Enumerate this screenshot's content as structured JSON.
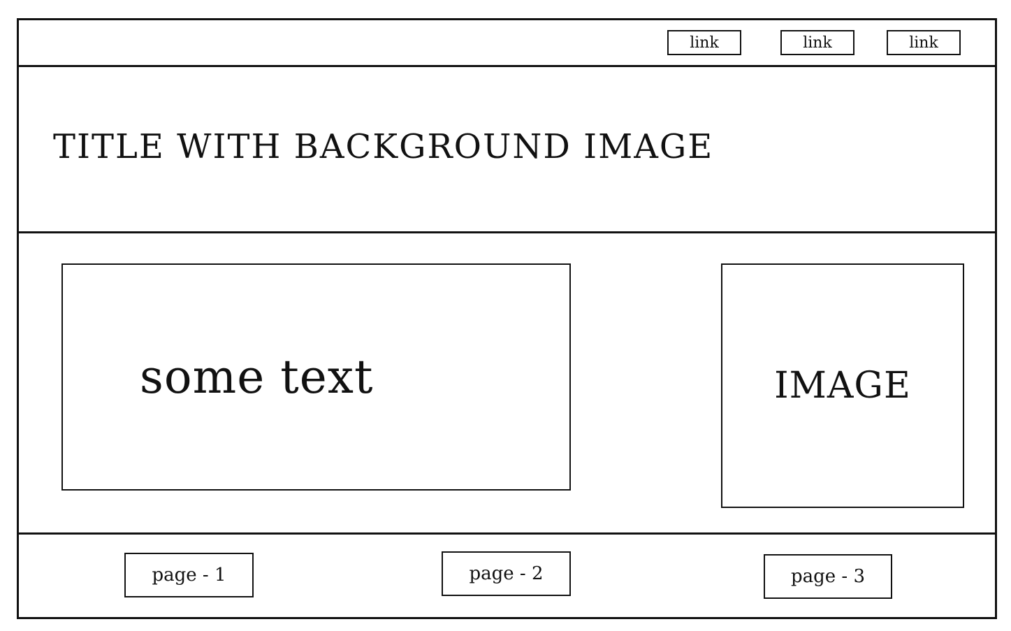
{
  "header": {
    "links": [
      "link",
      "link",
      "link"
    ]
  },
  "hero": {
    "title": "TITLE WITH BACKGROUND IMAGE"
  },
  "main": {
    "text_panel": "some text",
    "image_panel": "IMAGE"
  },
  "footer": {
    "pages": [
      "page - 1",
      "page - 2",
      "page - 3"
    ]
  }
}
